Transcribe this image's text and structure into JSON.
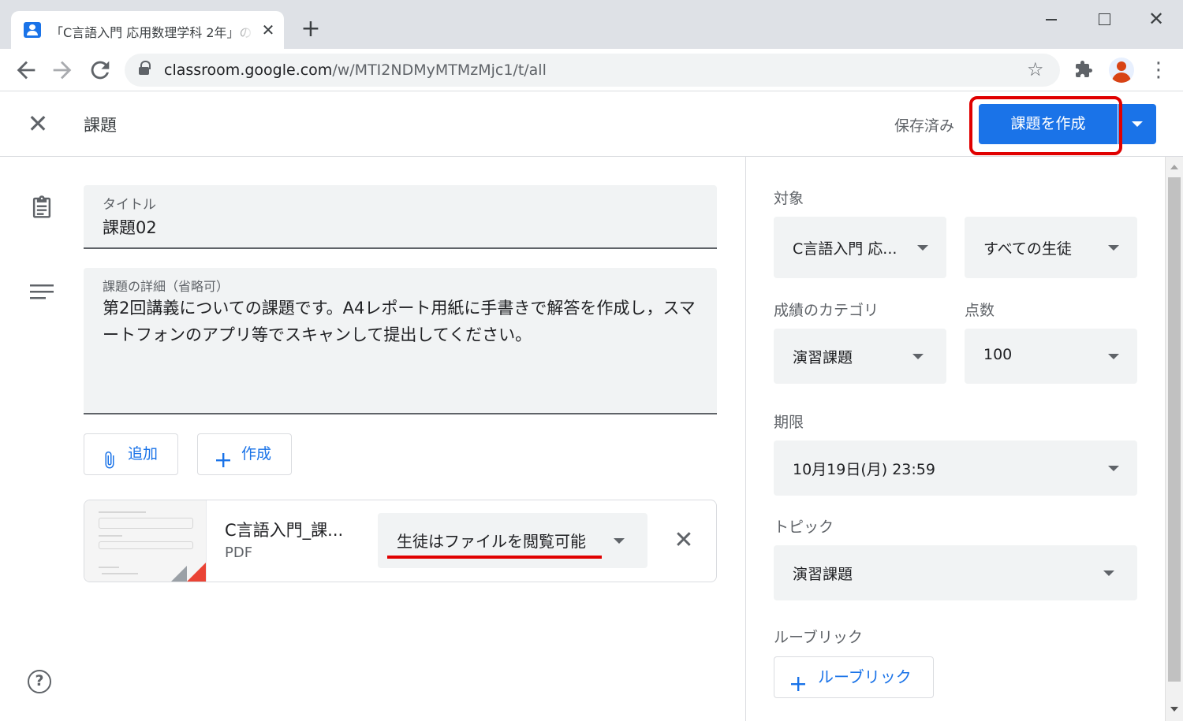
{
  "browser": {
    "tab_title": "「C言語入門 応用数理学科 2年」の",
    "tab_close": "✕",
    "new_tab": "+",
    "url_host": "classroom.google.com",
    "url_path": "/w/MTI2NDMyMTMzMjc1/t/all",
    "window_controls": {
      "minimize": "",
      "maximize": "",
      "close": "✕"
    },
    "icons": [
      "back-arrow-icon",
      "forward-arrow-icon",
      "reload-icon",
      "lock-icon",
      "star-icon",
      "extensions-puzzle-icon",
      "profile-avatar",
      "kebab-menu-icon"
    ]
  },
  "header": {
    "title": "課題",
    "saved_status": "保存済み",
    "create_button": "課題を作成",
    "highlight_color": "#e00000",
    "accent_color": "#1a73e8"
  },
  "form": {
    "title_label": "タイトル",
    "title_value": "課題02",
    "description_label": "課題の詳細（省略可）",
    "description_value": "第2回講義についての課題です。A4レポート用紙に手書きで解答を作成し，スマートフォンのアプリ等でスキャンして提出してください。",
    "add_button": "追加",
    "create_button": "作成",
    "attachment": {
      "name": "C言語入門_課...",
      "type": "PDF",
      "permission": "生徒はファイルを閲覧可能"
    }
  },
  "sidebar": {
    "for_label": "対象",
    "class_select": "C言語入門 応...",
    "students_select": "すべての生徒",
    "grade_category_label": "成績のカテゴリ",
    "grade_category_value": "演習課題",
    "points_label": "点数",
    "points_value": "100",
    "due_label": "期限",
    "due_value": "10月19日(月) 23:59",
    "topic_label": "トピック",
    "topic_value": "演習課題",
    "rubric_label": "ルーブリック",
    "rubric_button": "ルーブリック"
  }
}
